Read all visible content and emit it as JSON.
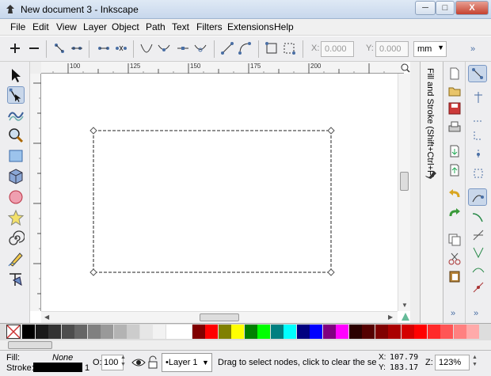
{
  "window": {
    "title": "New document 3 - Inkscape",
    "min_label": "─",
    "max_label": "□",
    "close_label": "X"
  },
  "menu": [
    {
      "label": "File"
    },
    {
      "label": "Edit"
    },
    {
      "label": "View"
    },
    {
      "label": "Layer"
    },
    {
      "label": "Object"
    },
    {
      "label": "Path"
    },
    {
      "label": "Text"
    },
    {
      "label": "Filters"
    },
    {
      "label": "Extensions"
    },
    {
      "label": "Help"
    }
  ],
  "tool_controls": {
    "x_label": "X:",
    "x_value": "0.000",
    "y_label": "Y:",
    "y_value": "0.000",
    "unit": "mm",
    "more": "»"
  },
  "ruler": {
    "h_ticks": [
      "100",
      "125",
      "150",
      "175",
      "200"
    ]
  },
  "dock": {
    "label": "Fill and Stroke (Shift+Ctrl+F)"
  },
  "statusbar": {
    "fill_label": "Fill:",
    "fill_value": "None",
    "stroke_label": "Stroke:",
    "stroke_width": "1",
    "opacity_label": "O:",
    "opacity_value": "100",
    "layer": "•Layer 1",
    "message": "Drag to select nodes, click to clear the select",
    "x_label": "X:",
    "x_value": "107.79",
    "y_label": "Y:",
    "y_value": "183.17",
    "zoom_label": "Z:",
    "zoom_value": "123%"
  },
  "colors": {
    "accent": "#4a6fa5",
    "node_color": "#888888"
  }
}
